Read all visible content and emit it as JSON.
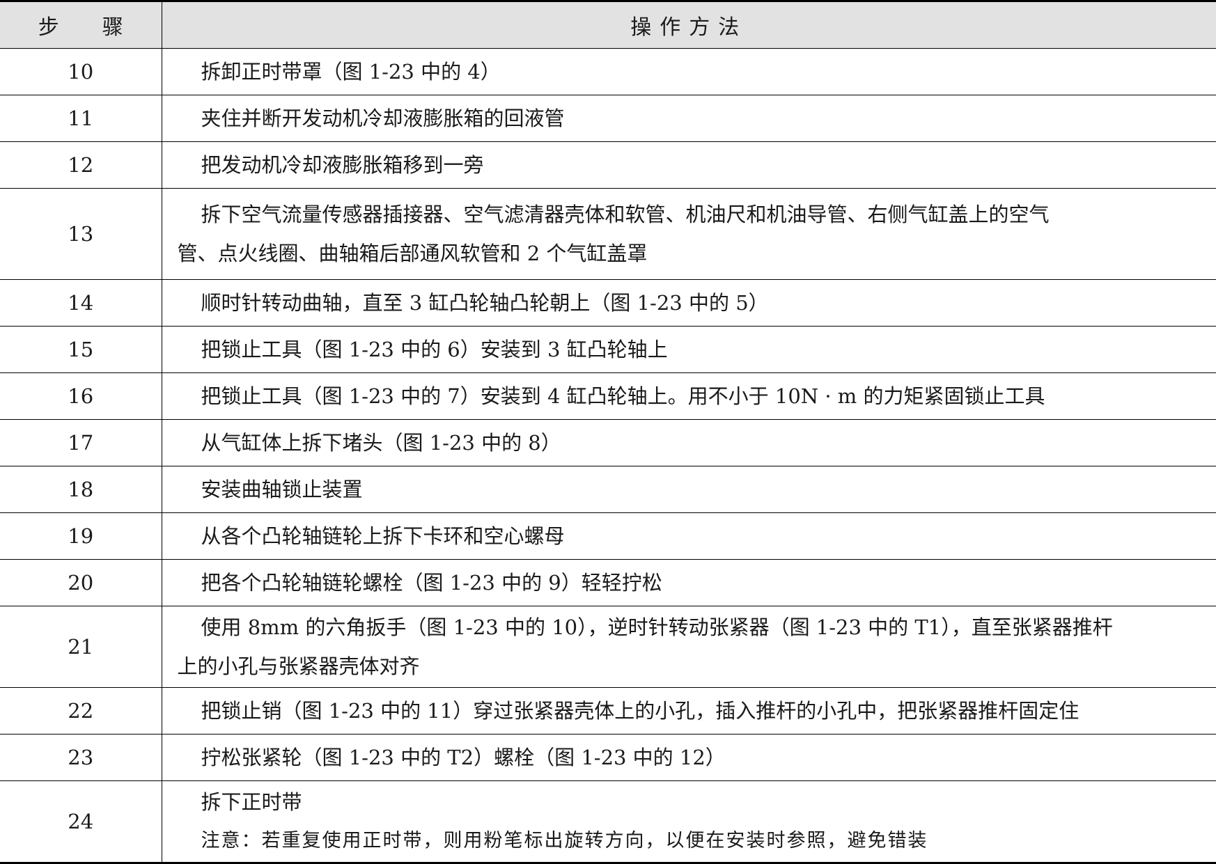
{
  "header": {
    "step_part1": "步",
    "step_part2": "骤",
    "method": "操作方法"
  },
  "rows": [
    {
      "step": "10",
      "lines": [
        "拆卸正时带罩（图 1-23 中的 4）"
      ]
    },
    {
      "step": "11",
      "lines": [
        "夹住并断开发动机冷却液膨胀箱的回液管"
      ]
    },
    {
      "step": "12",
      "lines": [
        "把发动机冷却液膨胀箱移到一旁"
      ]
    },
    {
      "step": "13",
      "lines": [
        "拆下空气流量传感器插接器、空气滤清器壳体和软管、机油尺和机油导管、右侧气缸盖上的空气",
        "管、点火线圈、曲轴箱后部通风软管和 2 个气缸盖罩"
      ]
    },
    {
      "step": "14",
      "lines": [
        "顺时针转动曲轴，直至 3 缸凸轮轴凸轮朝上（图 1-23 中的 5）"
      ]
    },
    {
      "step": "15",
      "lines": [
        "把锁止工具（图 1-23 中的 6）安装到 3 缸凸轮轴上"
      ]
    },
    {
      "step": "16",
      "lines": [
        "把锁止工具（图 1-23 中的 7）安装到 4 缸凸轮轴上。用不小于 10N · m 的力矩紧固锁止工具"
      ]
    },
    {
      "step": "17",
      "lines": [
        "从气缸体上拆下堵头（图 1-23 中的 8）"
      ]
    },
    {
      "step": "18",
      "lines": [
        "安装曲轴锁止装置"
      ]
    },
    {
      "step": "19",
      "lines": [
        "从各个凸轮轴链轮上拆下卡环和空心螺母"
      ]
    },
    {
      "step": "20",
      "lines": [
        "把各个凸轮轴链轮螺栓（图 1-23 中的 9）轻轻拧松"
      ]
    },
    {
      "step": "21",
      "lines": [
        "使用 8mm 的六角扳手（图 1-23 中的 10），逆时针转动张紧器（图 1-23 中的 T1），直至张紧器推杆",
        "上的小孔与张紧器壳体对齐"
      ]
    },
    {
      "step": "22",
      "lines": [
        "把锁止销（图 1-23 中的 11）穿过张紧器壳体上的小孔，插入推杆的小孔中，把张紧器推杆固定住"
      ]
    },
    {
      "step": "23",
      "lines": [
        "拧松张紧轮（图 1-23 中的 T2）螺栓（图 1-23 中的 12）"
      ]
    },
    {
      "step": "24",
      "lines": [
        "拆下正时带"
      ],
      "note": "注意：若重复使用正时带，则用粉笔标出旋转方向，以便在安装时参照，避免错装"
    }
  ]
}
